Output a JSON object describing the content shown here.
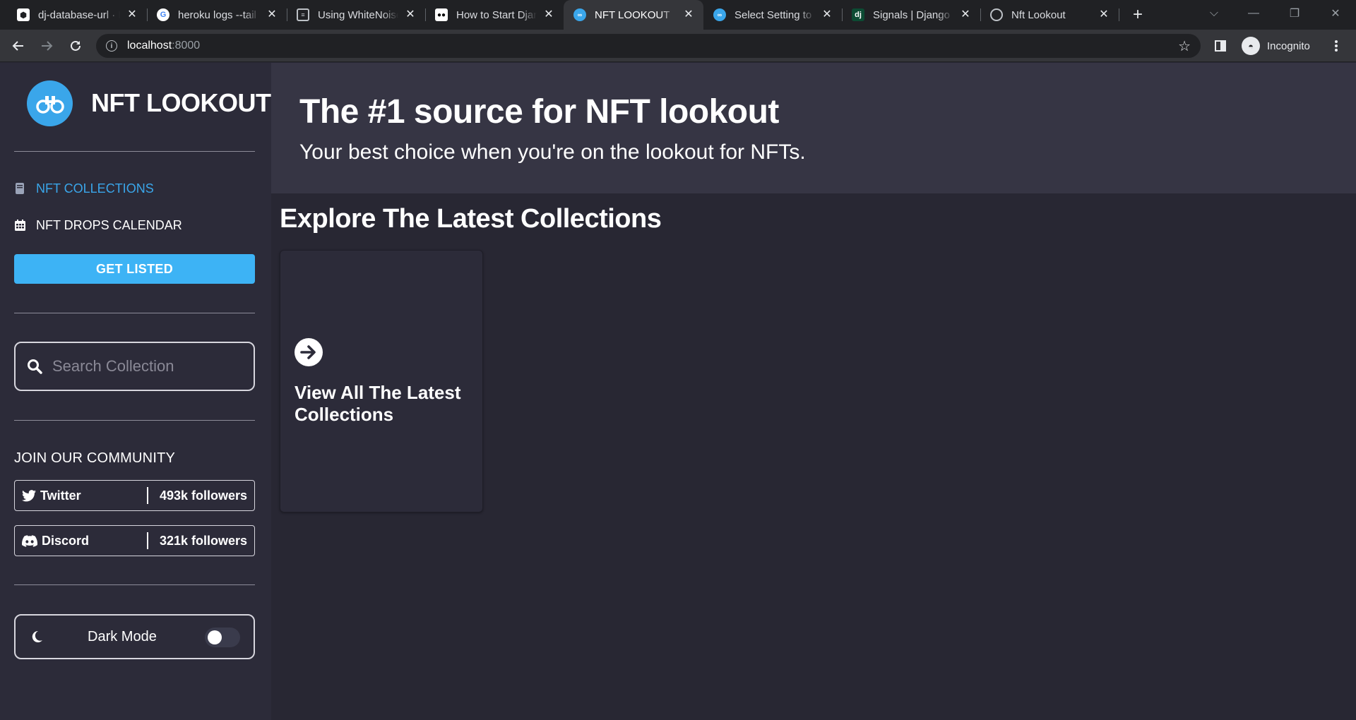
{
  "browser": {
    "tabs": [
      {
        "title": "dj-database-url · PyPI",
        "favicon": "cube-icon"
      },
      {
        "title": "heroku logs --tail - Google Search",
        "favicon": "google-icon"
      },
      {
        "title": "Using WhiteNoise with Django",
        "favicon": "doc-icon"
      },
      {
        "title": "How to Start Django Project",
        "favicon": "medium-icon"
      },
      {
        "title": "NFT LOOKOUT",
        "favicon": "binoculars-icon",
        "active": true
      },
      {
        "title": "Select Setting to change",
        "favicon": "binoculars-icon"
      },
      {
        "title": "Signals | Django documentation",
        "favicon": "django-icon"
      },
      {
        "title": "Nft Lookout",
        "favicon": "globe-icon"
      }
    ],
    "url_host": "localhost",
    "url_port": ":8000",
    "profile_label": "Incognito"
  },
  "sidebar": {
    "logo_text": "NFT LOOKOUT",
    "nav": [
      {
        "label": "NFT COLLECTIONS",
        "icon": "book-icon",
        "active": true
      },
      {
        "label": "NFT DROPS CALENDAR",
        "icon": "calendar-icon",
        "active": false
      }
    ],
    "cta_label": "GET LISTED",
    "search_placeholder": "Search Collection",
    "community_title": "JOIN OUR COMMUNITY",
    "socials": [
      {
        "name": "Twitter",
        "followers": "493k followers",
        "icon": "twitter-icon"
      },
      {
        "name": "Discord",
        "followers": "321k followers",
        "icon": "discord-icon"
      }
    ],
    "dark_mode_label": "Dark Mode",
    "dark_mode_on": false
  },
  "main": {
    "hero_title": "The #1 source for NFT lookout",
    "hero_subtitle": "Your best choice when you're on the lookout for NFTs.",
    "section_title": "Explore The Latest Collections",
    "card_text": "View All The Latest Collections"
  },
  "colors": {
    "accent": "#3aa6ea",
    "sidebar_bg": "#2c2b39",
    "hero_bg": "#363544",
    "page_bg": "#282733"
  }
}
